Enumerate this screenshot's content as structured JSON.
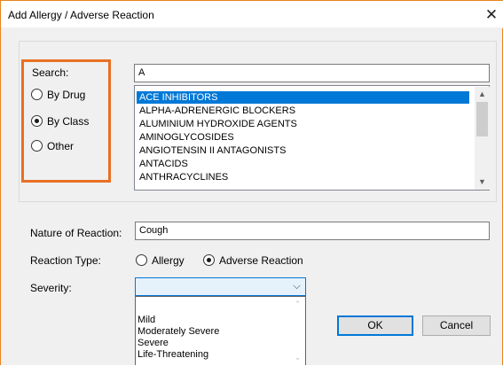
{
  "window": {
    "title": "Add Allergy / Adverse Reaction",
    "close_glyph": "✕"
  },
  "search": {
    "label": "Search:",
    "value": "A",
    "options": [
      {
        "label": "By Drug",
        "checked": false
      },
      {
        "label": "By Class",
        "checked": true
      },
      {
        "label": "Other",
        "checked": false
      }
    ],
    "list_items": [
      "ACE INHIBITORS",
      "ALPHA-ADRENERGIC BLOCKERS",
      "ALUMINIUM HYDROXIDE AGENTS",
      "AMINOGLYCOSIDES",
      "ANGIOTENSIN II ANTAGONISTS",
      "ANTACIDS",
      "ANTHRACYCLINES"
    ],
    "selected_index": 0
  },
  "nature": {
    "label": "Nature of Reaction:",
    "value": "Cough"
  },
  "reaction_type": {
    "label": "Reaction Type:",
    "options": [
      {
        "label": "Allergy",
        "checked": false
      },
      {
        "label": "Adverse Reaction",
        "checked": true
      }
    ]
  },
  "severity": {
    "label": "Severity:",
    "value": "",
    "options": [
      "Mild",
      "Moderately Severe",
      "Severe",
      "Life-Threatening"
    ]
  },
  "buttons": {
    "ok": "OK",
    "cancel": "Cancel"
  },
  "colors": {
    "highlight": "#e87023",
    "selection": "#0078d7",
    "window_border": "#e8841d"
  }
}
